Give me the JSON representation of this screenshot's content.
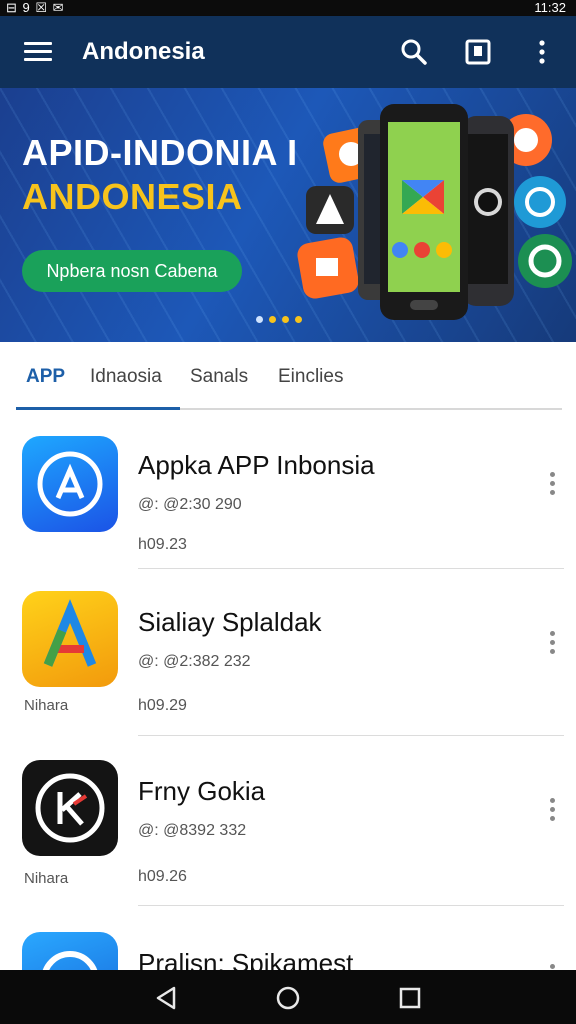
{
  "status_bar": {
    "left_icons_text": "⊟ 9 ☒ ✉",
    "time": "11:32"
  },
  "app_bar": {
    "title": "Andonesia",
    "icons": [
      "menu-icon",
      "search-icon",
      "square-icon",
      "more-vert-icon"
    ]
  },
  "banner": {
    "headline": "APID-INDONIA I",
    "subheadline": "ANDONESIA",
    "cta": "Npbera nosn Cabena",
    "dots_total": 4,
    "colors": {
      "headline": "#ffffff",
      "subheadline": "#f7c31c",
      "cta_bg": "#1aa15a"
    }
  },
  "tabs": [
    {
      "label": "APP",
      "active": true
    },
    {
      "label": "Idnaosia",
      "active": false
    },
    {
      "label": "Sanals",
      "active": false
    },
    {
      "label": "Einclies",
      "active": false
    }
  ],
  "apps": [
    {
      "name": "Appka APP Inbonsia",
      "meta": "@: @2:30 290",
      "size": "h09.23",
      "developer": "",
      "icon": "a-logo-icon"
    },
    {
      "name": "Sialiay Splaldak",
      "meta": "@: @2:382 232",
      "size": "h09.29",
      "developer": "Nihara",
      "icon": "colored-a-icon"
    },
    {
      "name": "Frny Gokia",
      "meta": "@: @8392 332",
      "size": "h09.26",
      "developer": "Nihara",
      "icon": "k-circle-icon"
    },
    {
      "name": "Pralisn: Spikamest",
      "meta": "",
      "size": "",
      "developer": "",
      "icon": "blue-circle-icon"
    }
  ],
  "nav_bar": {
    "icons": [
      "back-icon",
      "home-icon",
      "recents-icon"
    ]
  }
}
